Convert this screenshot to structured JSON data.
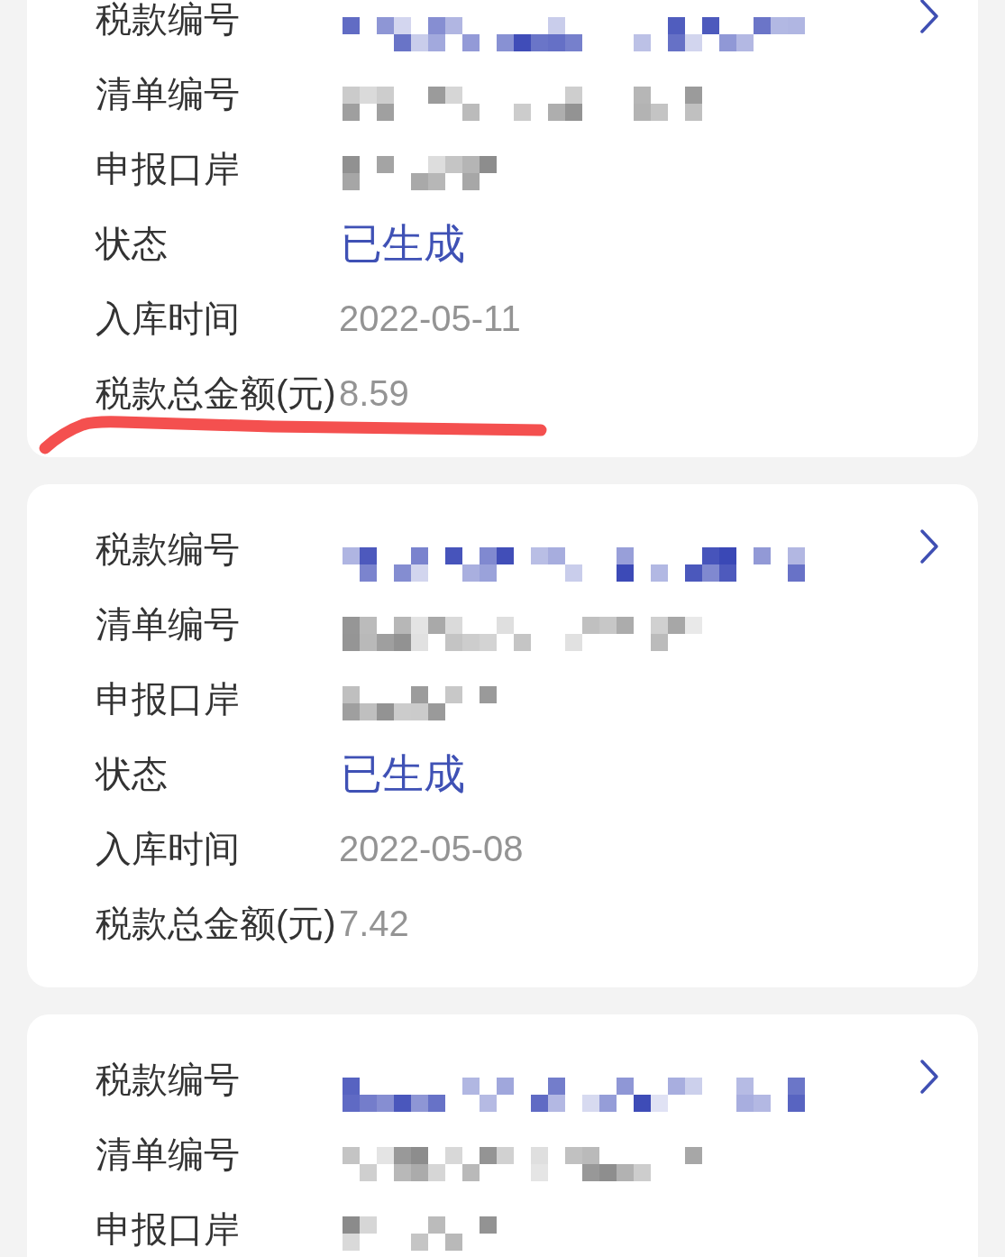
{
  "cards": [
    {
      "underlined": true,
      "rows": [
        {
          "label": "税款编号",
          "kind": "masked",
          "accent": true
        },
        {
          "label": "清单编号",
          "kind": "masked",
          "accent": false
        },
        {
          "label": "申报口岸",
          "kind": "masked",
          "accent": false
        },
        {
          "label": "状态",
          "kind": "status",
          "value": "已生成"
        },
        {
          "label": "入库时间",
          "kind": "text",
          "value": "2022-05-11"
        },
        {
          "label": "税款总金额(元)",
          "kind": "text",
          "value": "8.59"
        }
      ]
    },
    {
      "underlined": false,
      "rows": [
        {
          "label": "税款编号",
          "kind": "masked",
          "accent": true
        },
        {
          "label": "清单编号",
          "kind": "masked",
          "accent": false
        },
        {
          "label": "申报口岸",
          "kind": "masked",
          "accent": false
        },
        {
          "label": "状态",
          "kind": "status",
          "value": "已生成"
        },
        {
          "label": "入库时间",
          "kind": "text",
          "value": "2022-05-08"
        },
        {
          "label": "税款总金额(元)",
          "kind": "text",
          "value": "7.42"
        }
      ]
    },
    {
      "underlined": false,
      "rows": [
        {
          "label": "税款编号",
          "kind": "masked",
          "accent": true
        },
        {
          "label": "清单编号",
          "kind": "masked",
          "accent": false
        },
        {
          "label": "申报口岸",
          "kind": "masked",
          "accent": false
        }
      ]
    }
  ]
}
